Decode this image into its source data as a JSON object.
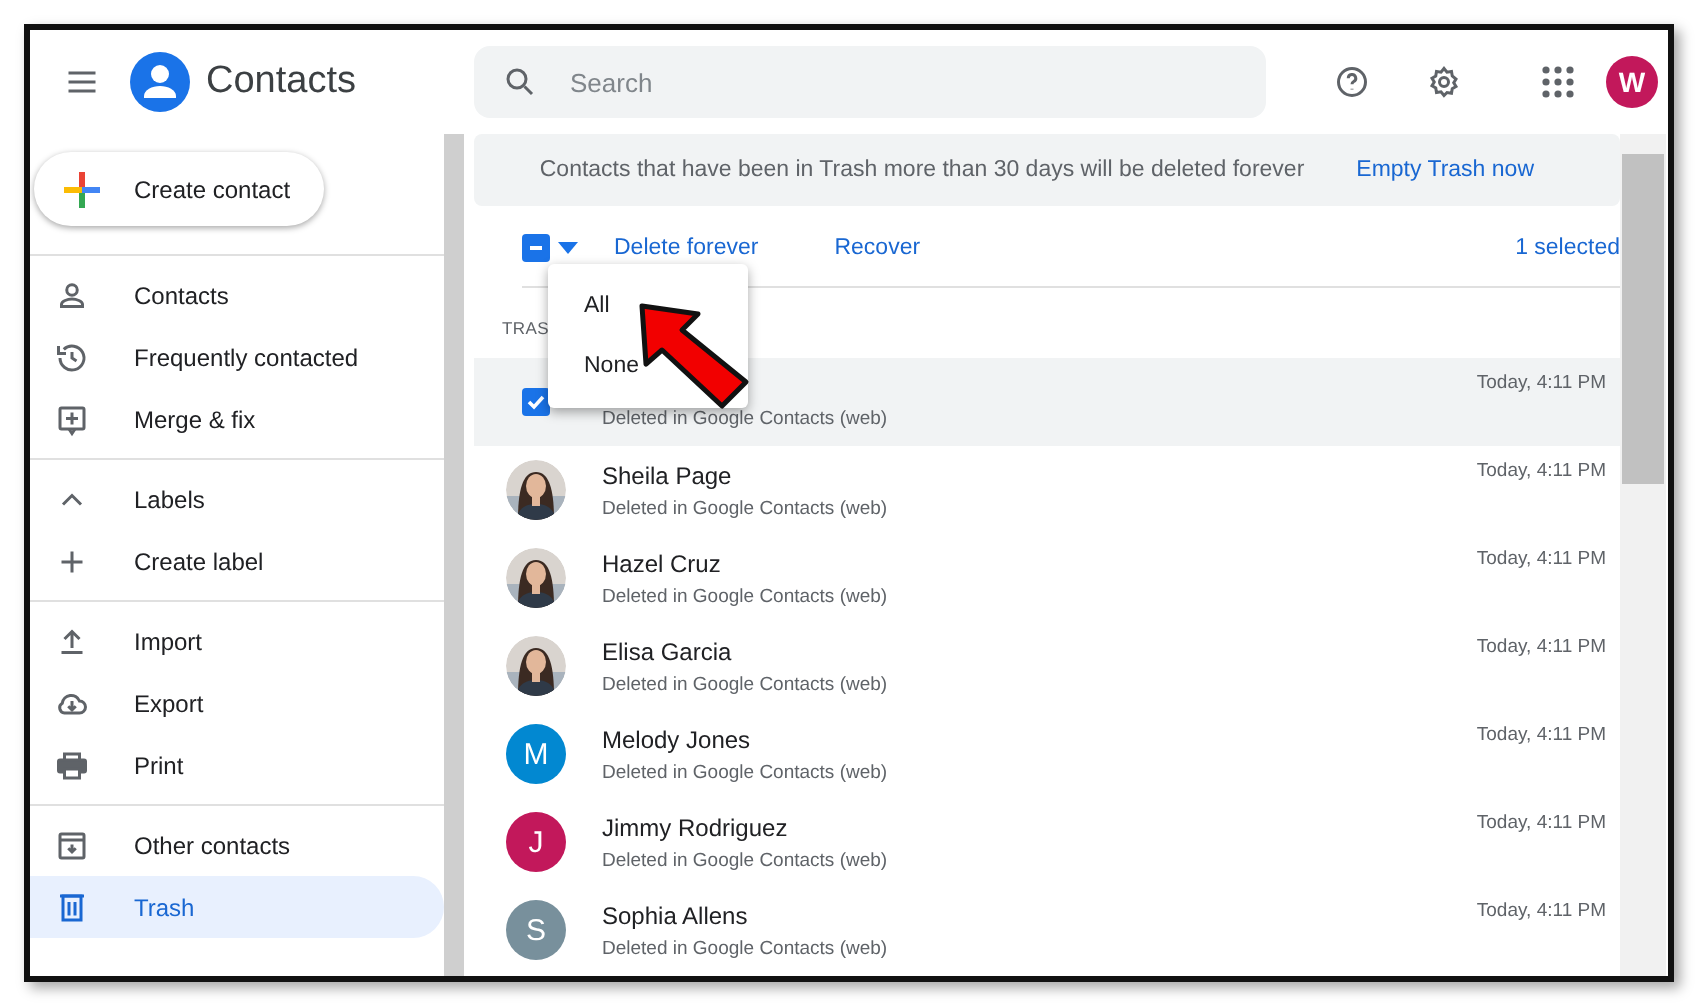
{
  "header": {
    "title": "Contacts",
    "search": {
      "placeholder": "Search"
    },
    "account": {
      "initial": "W",
      "color": "#c2185b"
    }
  },
  "sidebar": {
    "create_button": "Create contact",
    "sections": [
      {
        "items": [
          {
            "label": "Contacts",
            "selected": false
          },
          {
            "label": "Frequently contacted",
            "selected": false
          },
          {
            "label": "Merge & fix",
            "selected": false
          }
        ]
      },
      {
        "header": {
          "label": "Labels",
          "expanded": true
        },
        "items": [
          {
            "label": "Create label",
            "selected": false
          }
        ]
      },
      {
        "items": [
          {
            "label": "Import",
            "selected": false
          },
          {
            "label": "Export",
            "selected": false
          },
          {
            "label": "Print",
            "selected": false
          }
        ]
      },
      {
        "items": [
          {
            "label": "Other contacts",
            "selected": false
          },
          {
            "label": "Trash",
            "selected": true
          }
        ]
      }
    ]
  },
  "banner": {
    "text": "Contacts that have been in Trash more than 30 days will be deleted forever",
    "action": "Empty Trash now"
  },
  "toolbar": {
    "select_all_checked": true,
    "select_all_partial": true,
    "actions": [
      "Delete forever",
      "Recover"
    ],
    "selection_count": "1 selected"
  },
  "select_menu": {
    "items": [
      "All",
      "None"
    ]
  },
  "section_label": "TRAS",
  "rows": [
    {
      "selected": true,
      "subtitle": "Deleted in Google Contacts (web)",
      "time": "Today, 4:11 PM"
    },
    {
      "selected": false,
      "name": "Sheila Page",
      "subtitle": "Deleted in Google Contacts (web)",
      "time": "Today, 4:11 PM"
    },
    {
      "selected": false,
      "name": "Hazel Cruz",
      "subtitle": "Deleted in Google Contacts (web)",
      "time": "Today, 4:11 PM"
    },
    {
      "selected": false,
      "name": "Elisa Garcia",
      "subtitle": "Deleted in Google Contacts (web)",
      "time": "Today, 4:11 PM"
    },
    {
      "selected": false,
      "name": "Melody Jones",
      "subtitle": "Deleted in Google Contacts (web)",
      "time": "Today, 4:11 PM",
      "avatar": {
        "kind": "initial",
        "initial": "M",
        "color": "#0288d1"
      }
    },
    {
      "selected": false,
      "name": "Jimmy Rodriguez",
      "subtitle": "Deleted in Google Contacts (web)",
      "time": "Today, 4:11 PM",
      "avatar": {
        "kind": "initial",
        "initial": "J",
        "color": "#c2185b"
      }
    },
    {
      "selected": false,
      "name": "Sophia Allens",
      "subtitle": "Deleted in Google Contacts (web)",
      "time": "Today, 4:11 PM",
      "avatar": {
        "kind": "initial",
        "initial": "S",
        "color": "#78909c"
      }
    }
  ]
}
